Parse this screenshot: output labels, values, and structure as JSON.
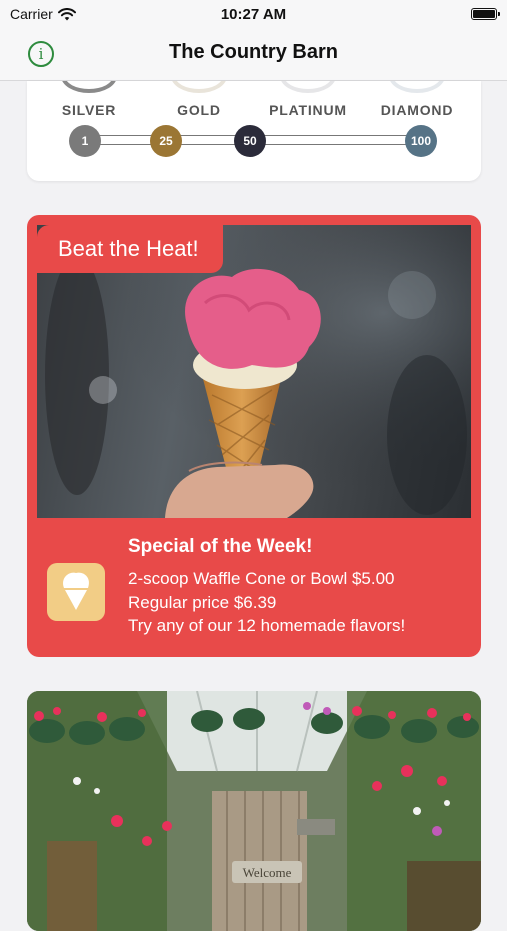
{
  "status_bar": {
    "carrier": "Carrier",
    "time": "10:27 AM"
  },
  "nav": {
    "title": "The Country Barn",
    "info_icon": "info-circle-icon",
    "info_glyph": "i"
  },
  "tiers": {
    "names": [
      "SILVER",
      "GOLD",
      "PLATINUM",
      "DIAMOND"
    ],
    "milestones": [
      "1",
      "25",
      "50",
      "100"
    ],
    "colors": {
      "silver": "#7a7a7a",
      "gold": "#9b7634",
      "platinum": "#2b2b3a",
      "diamond": "#567386"
    }
  },
  "promo": {
    "tag": "Beat the Heat!",
    "headline": "Special of the Week!",
    "lines": [
      "2-scoop Waffle Cone or Bowl $5.00",
      "Regular price $6.39",
      "Try any of our 12 homemade flavors!"
    ],
    "icon": "ice-cream-cone-icon",
    "colors": {
      "card": "#e84a49",
      "icon_bg": "#f2cd86"
    }
  },
  "garden": {
    "sign_text": "Welcome"
  }
}
